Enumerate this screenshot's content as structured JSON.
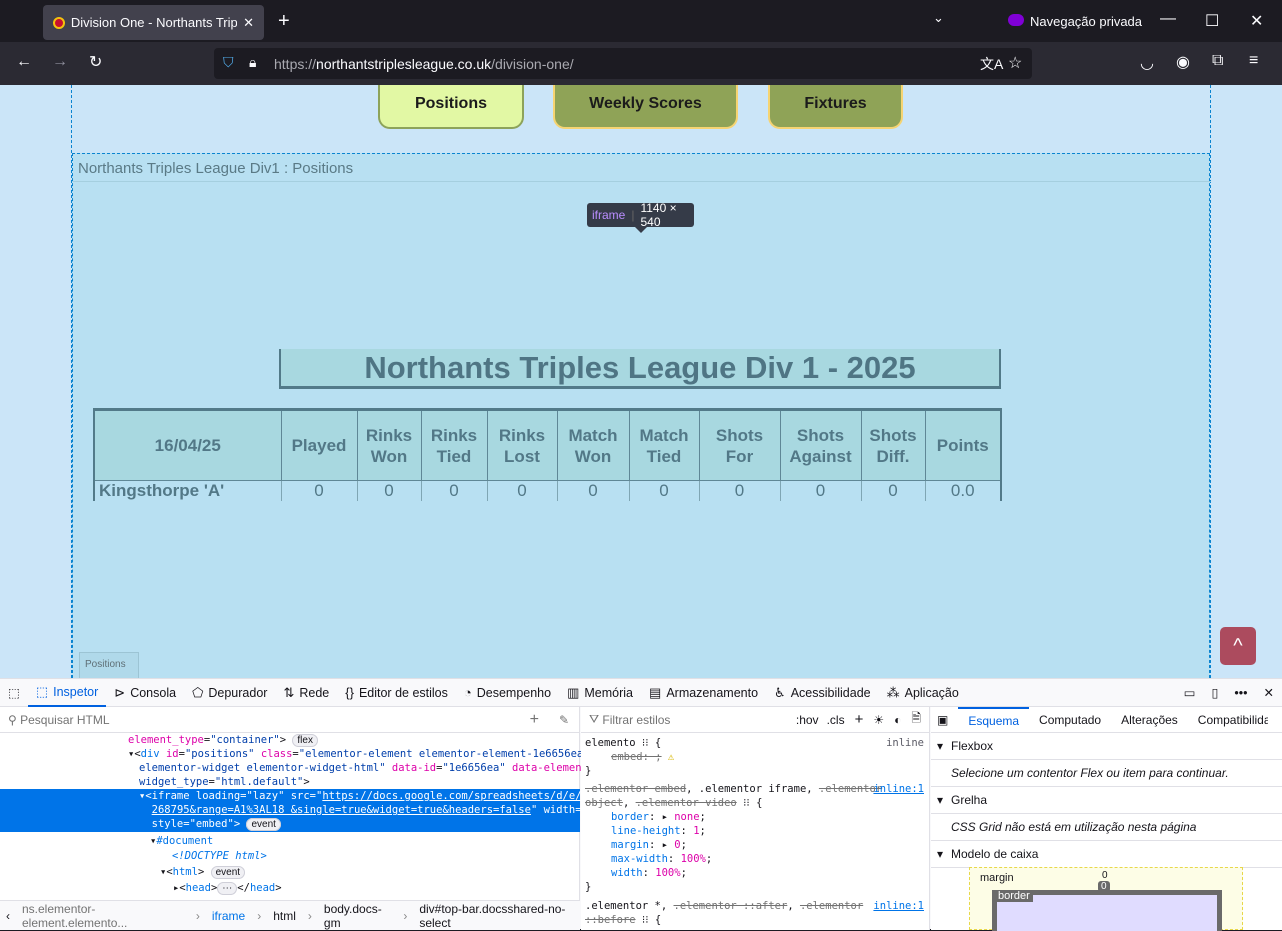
{
  "browser": {
    "tab_title": "Division One - Northants Triples League",
    "private_label": "Navegação privada",
    "url_prefix": "https://",
    "url_domain": "northantstriplesleague.co.uk",
    "url_path": "/division-one/"
  },
  "site": {
    "nav": [
      "Positions",
      "Weekly Scores",
      "Fixtures"
    ],
    "embed_title": "Northants Triples League Div1 : Positions",
    "sheet_tab": "Positions",
    "tooltip_tag": "iframe",
    "tooltip_size": "1140 × 540",
    "to_top": "^"
  },
  "sheet": {
    "title": "Northants Triples League Div 1 - 2025",
    "date": "16/04/25",
    "headers": [
      [
        "Played"
      ],
      [
        "Rinks",
        "Won"
      ],
      [
        "Rinks",
        "Tied"
      ],
      [
        "Rinks",
        "Lost"
      ],
      [
        "Match",
        "Won"
      ],
      [
        "Match",
        "Tied"
      ],
      [
        "Shots",
        "For"
      ],
      [
        "Shots",
        "Against"
      ],
      [
        "Shots",
        "Diff."
      ],
      [
        "Points"
      ]
    ],
    "rows": [
      {
        "team": "Kingsthorpe 'A'",
        "values": [
          "0",
          "0",
          "0",
          "0",
          "0",
          "0",
          "0",
          "0",
          "0",
          "0.0"
        ]
      }
    ]
  },
  "devtools": {
    "tabs": [
      "Inspetor",
      "Consola",
      "Depurador",
      "Rede",
      "Editor de estilos",
      "Desempenho",
      "Memória",
      "Armazenamento",
      "Acessibilidade",
      "Aplicação"
    ],
    "search_placeholder": "Pesquisar HTML",
    "filter_placeholder": "Filtrar estilos",
    "hov": ":hov",
    "cls": ".cls",
    "layout_tabs": [
      "Esquema",
      "Computado",
      "Alterações",
      "Compatibilidade"
    ],
    "flexbox": "Flexbox",
    "flex_msg": "Selecione um contentor Flex ou item para continuar.",
    "grid": "Grelha",
    "grid_msg": "CSS Grid não está em utilização nesta página",
    "boxmodel": "Modelo de caixa",
    "margin_label": "margin",
    "border_label": "border",
    "margin_val": "0",
    "border_val": "0",
    "breadcrumbs": [
      "ns.elementor-element.elemento...",
      "iframe",
      "html",
      "body.docs-gm",
      "div#top-bar.docsshared-no-select"
    ],
    "inline": "inline",
    "inline1": "inline:1"
  }
}
